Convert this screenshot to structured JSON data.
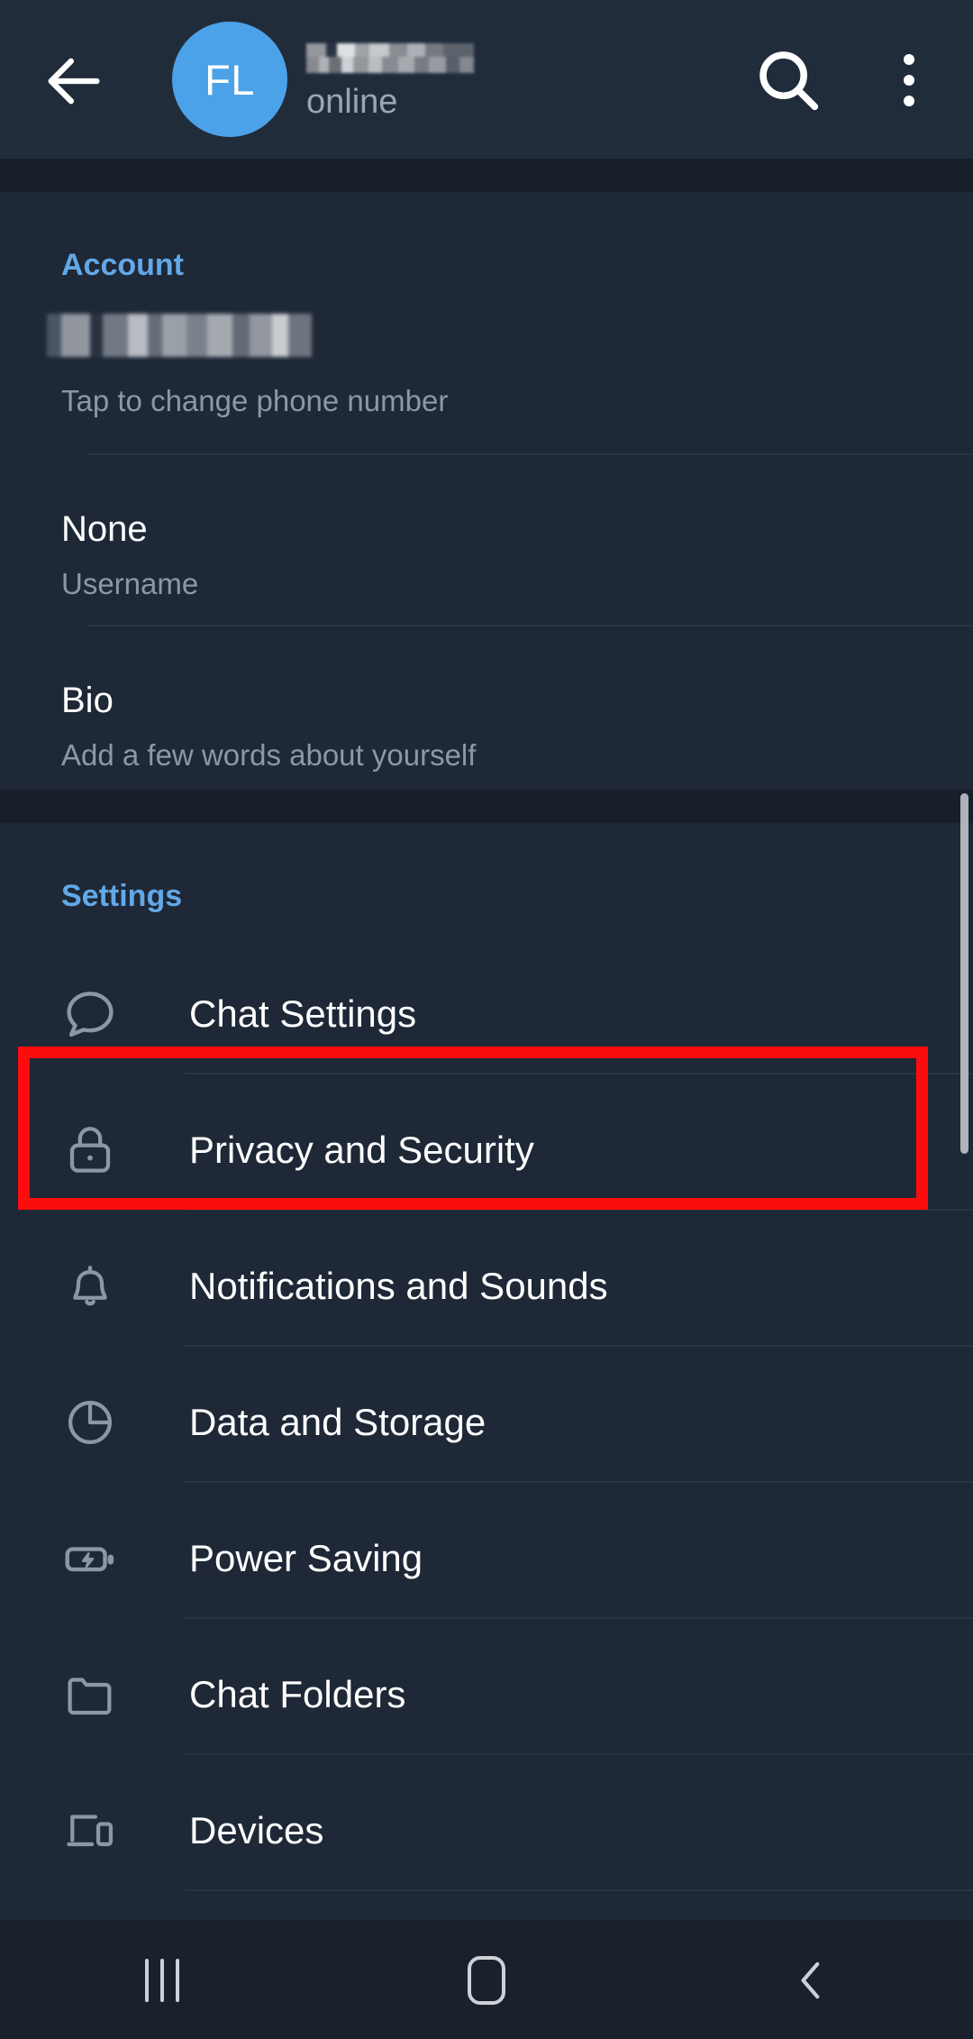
{
  "app": {
    "background_color": "#1b2431",
    "section_background": "#1e2836",
    "accent_color": "#62a8e8",
    "highlight_color": "#fc0d0d"
  },
  "header": {
    "back_icon": "back-arrow-icon",
    "avatar_initials": "FL",
    "avatar_color": "#4ca2e8",
    "contact_name": "",
    "status": "online",
    "search_icon": "search-icon",
    "menu_icon": "overflow-menu-icon"
  },
  "account": {
    "title": "Account",
    "rows": [
      {
        "value": "",
        "label": "Tap to change phone number",
        "redacted": true
      },
      {
        "value": "None",
        "label": "Username",
        "redacted": false
      },
      {
        "value": "Bio",
        "label": "Add a few words about yourself",
        "redacted": false
      }
    ]
  },
  "settings": {
    "title": "Settings",
    "items": [
      {
        "label": "Chat Settings",
        "icon": "chat-bubble-icon",
        "highlighted": false
      },
      {
        "label": "Privacy and Security",
        "icon": "lock-icon",
        "highlighted": true
      },
      {
        "label": "Notifications and Sounds",
        "icon": "bell-icon",
        "highlighted": false
      },
      {
        "label": "Data and Storage",
        "icon": "pie-chart-icon",
        "highlighted": false
      },
      {
        "label": "Power Saving",
        "icon": "battery-bolt-icon",
        "highlighted": false
      },
      {
        "label": "Chat Folders",
        "icon": "folder-icon",
        "highlighted": false
      },
      {
        "label": "Devices",
        "icon": "devices-icon",
        "highlighted": false
      }
    ]
  },
  "navbar": {
    "recents_icon": "recents-icon",
    "home_icon": "home-icon",
    "back_icon": "nav-back-icon"
  }
}
